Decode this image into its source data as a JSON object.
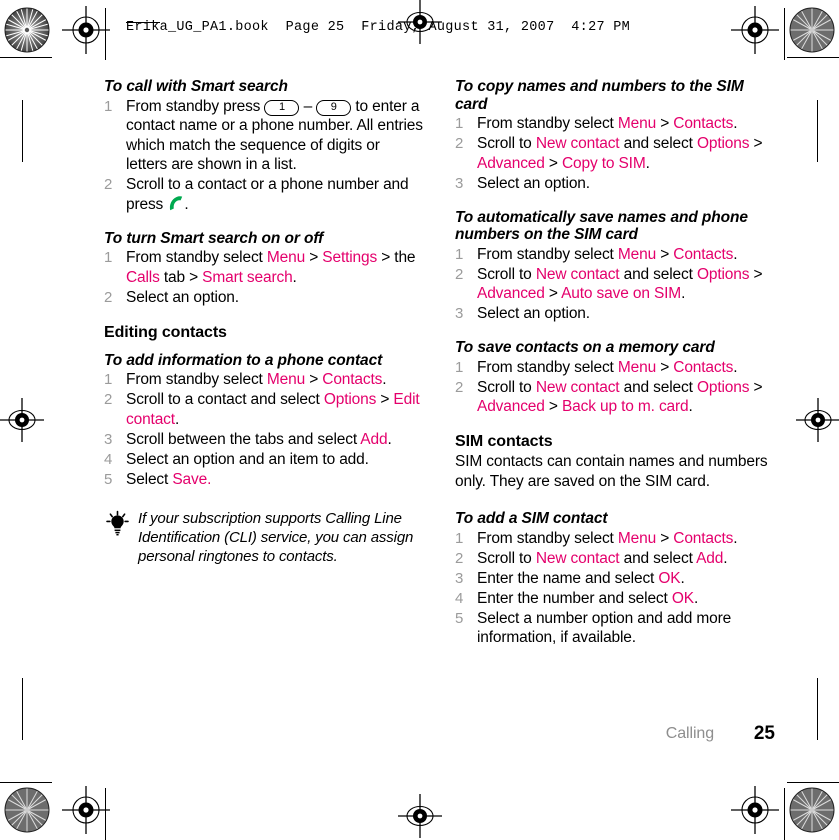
{
  "header": {
    "slug": "Erika_UG_PA1.book  Page 25  Friday, August 31, 2007  4:27 PM"
  },
  "footer": {
    "chapter": "Calling",
    "page_number": "25"
  },
  "colors": {
    "ui_string": "#e4006c",
    "step_number": "#9b9b9b",
    "chapter": "#8e8e8e",
    "call_icon": "#00a94f",
    "body_text": "#000000"
  },
  "left_column": {
    "section_1": {
      "heading": "To call with Smart search",
      "step_1": {
        "part_a": "From standby press ",
        "key_low": "1",
        "dash": " – ",
        "key_high": "9",
        "part_b": " to enter a contact name or a phone number. All entries which match the sequence of digits or letters are shown in a list."
      },
      "step_2": {
        "part_a": "Scroll to a contact or a phone number and press ",
        "icon": "call-icon",
        "part_b": "."
      }
    },
    "section_2": {
      "heading": "To turn Smart search on or off",
      "step_1": {
        "a": "From standby select ",
        "ui_1": "Menu",
        "b": " > ",
        "ui_2": "Settings",
        "c": " > the ",
        "ui_3": "Calls",
        "d": " tab > ",
        "ui_4": "Smart search",
        "e": "."
      },
      "step_2": "Select an option."
    },
    "section_3_heading": "Editing contacts",
    "section_4": {
      "heading": "To add information to a phone contact",
      "step_1": {
        "a": "From standby select ",
        "ui_1": "Menu",
        "b": " > ",
        "ui_2": " Contacts",
        "c": "."
      },
      "step_2": {
        "a": "Scroll to a contact and select ",
        "ui_1": "Options",
        "b": " > ",
        "ui_2": "Edit contact",
        "c": "."
      },
      "step_3": {
        "a": "Scroll between the tabs and select ",
        "ui_1": "Add",
        "b": "."
      },
      "step_4": "Select an option and an item to add.",
      "step_5": {
        "a": "Select ",
        "ui_1": "Save.",
        "b": ""
      }
    },
    "tip": {
      "icon": "lightbulb-icon",
      "text": "If your subscription supports Calling Line Identification (CLI) service, you can assign personal ringtones to contacts."
    }
  },
  "right_column": {
    "section_1": {
      "heading": "To copy names and numbers to the SIM card",
      "step_1": {
        "a": "From standby select ",
        "ui_1": "Menu",
        "b": " > ",
        "ui_2": " Contacts",
        "c": "."
      },
      "step_2": {
        "a": "Scroll to ",
        "ui_1": "New contact",
        "b": " and select ",
        "ui_2": "Options",
        "c": " > ",
        "ui_3": "Advanced",
        "d": " > ",
        "ui_4": "Copy to SIM",
        "e": "."
      },
      "step_3": "Select an option."
    },
    "section_2": {
      "heading": "To automatically save names and phone numbers on the SIM card",
      "step_1": {
        "a": "From standby select ",
        "ui_1": "Menu",
        "b": " > ",
        "ui_2": " Contacts",
        "c": "."
      },
      "step_2": {
        "a": "Scroll to ",
        "ui_1": "New contact",
        "b": " and select ",
        "ui_2": "Options",
        "c": " > ",
        "ui_3": "Advanced",
        "d": " > ",
        "ui_4": "Auto save on SIM",
        "e": "."
      },
      "step_3": "Select an option."
    },
    "section_3": {
      "heading": "To save contacts on a memory card",
      "step_1": {
        "a": "From standby select ",
        "ui_1": "Menu",
        "b": " > ",
        "ui_2": " Contacts",
        "c": "."
      },
      "step_2": {
        "a": "Scroll to ",
        "ui_1": "New contact",
        "b": " and select ",
        "ui_2": "Options",
        "c": " > ",
        "ui_3": "Advanced",
        "d": " > ",
        "ui_4": "Back up to m. card",
        "e": "."
      }
    },
    "section_4": {
      "heading": "SIM contacts",
      "body": "SIM contacts can contain names and numbers only. They are saved on the SIM card."
    },
    "section_5": {
      "heading": "To add a SIM contact",
      "step_1": {
        "a": "From standby select ",
        "ui_1": "Menu",
        "b": " > ",
        "ui_2": " Contacts",
        "c": "."
      },
      "step_2": {
        "a": "Scroll to ",
        "ui_1": "New contact",
        "b": " and select ",
        "ui_2": "Add",
        "c": "."
      },
      "step_3": {
        "a": "Enter the name and select ",
        "ui_1": "OK",
        "b": "."
      },
      "step_4": {
        "a": "Enter the number and select ",
        "ui_1": "OK",
        "b": "."
      },
      "step_5": "Select a number option and add more information, if available."
    }
  }
}
